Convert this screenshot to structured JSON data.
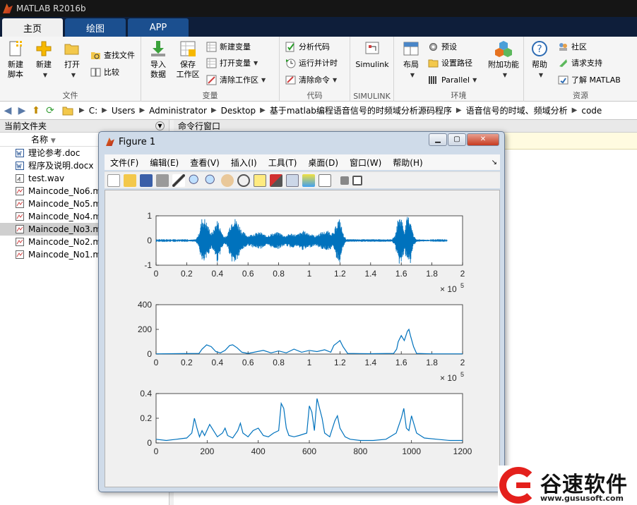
{
  "window": {
    "title": "MATLAB R2016b"
  },
  "tabs": [
    {
      "label": "主页"
    },
    {
      "label": "绘图"
    },
    {
      "label": "APP"
    }
  ],
  "ribbon": {
    "file": {
      "name": "文件",
      "new_script": "新建\n脚本",
      "new": "新建",
      "open": "打开",
      "find_files": "查找文件",
      "compare": "比较"
    },
    "variable": {
      "name": "变量",
      "import": "导入\n数据",
      "save_ws": "保存\n工作区",
      "new_var": "新建变量",
      "open_var": "打开变量",
      "clear_ws": "清除工作区"
    },
    "code": {
      "name": "代码",
      "analyze": "分析代码",
      "run_time": "运行并计时",
      "clear_cmds": "清除命令"
    },
    "simulink": {
      "name": "SIMULINK",
      "label": "Simulink"
    },
    "env": {
      "name": "环境",
      "layout": "布局",
      "prefs": "预设",
      "set_path": "设置路径",
      "parallel": "Parallel",
      "addons": "附加功能"
    },
    "resources": {
      "name": "资源",
      "help": "帮助",
      "community": "社区",
      "support": "请求支持",
      "learn": "了解 MATLAB"
    }
  },
  "address": {
    "segments": [
      "C:",
      "Users",
      "Administrator",
      "Desktop",
      "基于matlab编程语音信号的时频域分析源码程序",
      "语音信号的时域、频域分析",
      "code"
    ]
  },
  "current_folder": {
    "title": "当前文件夹",
    "col_name": "名称",
    "files": [
      {
        "name": "理论参考.doc",
        "type": "doc"
      },
      {
        "name": "程序及说明.docx",
        "type": "doc"
      },
      {
        "name": "test.wav",
        "type": "wav"
      },
      {
        "name": "Maincode_No6.m",
        "type": "m"
      },
      {
        "name": "Maincode_No5.m",
        "type": "m"
      },
      {
        "name": "Maincode_No4.m",
        "type": "m"
      },
      {
        "name": "Maincode_No3.m",
        "type": "m",
        "selected": true
      },
      {
        "name": "Maincode_No2.m",
        "type": "m"
      },
      {
        "name": "Maincode_No1.m",
        "type": "m"
      }
    ]
  },
  "command_window": {
    "title": "命令行窗口"
  },
  "figure": {
    "title": "Figure 1",
    "menu": [
      "文件(F)",
      "编辑(E)",
      "查看(V)",
      "插入(I)",
      "工具(T)",
      "桌面(D)",
      "窗口(W)",
      "帮助(H)"
    ]
  },
  "chart_data": [
    {
      "type": "line",
      "ylim": [
        -1,
        1
      ],
      "xlim": [
        0,
        2
      ],
      "xticks": [
        "0",
        "0.2",
        "0.4",
        "0.6",
        "0.8",
        "1",
        "1.2",
        "1.4",
        "1.6",
        "1.8",
        "2"
      ],
      "yticks": [
        "1",
        "0",
        "-1"
      ],
      "exponent": "× 10",
      "exponent_power": "5",
      "envelope_x": [
        0,
        0.2,
        0.26,
        0.28,
        0.3,
        0.32,
        0.34,
        0.36,
        0.38,
        0.4,
        0.42,
        0.44,
        0.46,
        0.48,
        0.5,
        0.52,
        0.54,
        0.56,
        0.58,
        0.6,
        0.64,
        0.68,
        0.72,
        0.76,
        0.8,
        0.84,
        0.88,
        0.92,
        0.96,
        1.0,
        1.04,
        1.08,
        1.12,
        1.16,
        1.18,
        1.2,
        1.22,
        1.24,
        1.3,
        1.4,
        1.5,
        1.54,
        1.56,
        1.58,
        1.6,
        1.62,
        1.64,
        1.66,
        1.68,
        1.7,
        1.8,
        1.9,
        1.92,
        2.0
      ],
      "envelope_y": [
        0.02,
        0.02,
        0.05,
        0.3,
        0.95,
        0.9,
        0.6,
        0.3,
        0.5,
        0.9,
        0.5,
        0.2,
        0.15,
        0.6,
        0.95,
        0.9,
        0.7,
        0.4,
        0.3,
        0.2,
        0.3,
        0.35,
        0.2,
        0.3,
        0.35,
        0.2,
        0.3,
        0.25,
        0.4,
        0.3,
        0.2,
        0.35,
        0.4,
        0.3,
        0.8,
        0.9,
        0.3,
        0.05,
        0.05,
        0.05,
        0.05,
        0.05,
        0.2,
        0.95,
        1.0,
        0.4,
        1.0,
        0.95,
        0.2,
        0.05,
        0.02,
        0.02,
        0.0,
        0.0
      ]
    },
    {
      "type": "line",
      "ylim": [
        0,
        400
      ],
      "xlim": [
        0,
        2
      ],
      "xticks": [
        "0",
        "0.2",
        "0.4",
        "0.6",
        "0.8",
        "1",
        "1.2",
        "1.4",
        "1.6",
        "1.8",
        "2"
      ],
      "yticks": [
        "400",
        "200",
        "0"
      ],
      "exponent": "× 10",
      "exponent_power": "5",
      "x": [
        0,
        0.28,
        0.3,
        0.33,
        0.36,
        0.39,
        0.42,
        0.45,
        0.48,
        0.5,
        0.53,
        0.56,
        0.6,
        0.7,
        0.75,
        0.8,
        0.85,
        0.9,
        0.95,
        1.0,
        1.05,
        1.1,
        1.14,
        1.16,
        1.18,
        1.2,
        1.22,
        1.25,
        1.4,
        1.55,
        1.57,
        1.58,
        1.6,
        1.62,
        1.64,
        1.65,
        1.66,
        1.68,
        1.7,
        1.8,
        2.0
      ],
      "y": [
        2,
        5,
        40,
        75,
        60,
        20,
        10,
        30,
        70,
        75,
        50,
        15,
        5,
        30,
        10,
        25,
        10,
        40,
        15,
        30,
        20,
        35,
        15,
        70,
        90,
        110,
        60,
        5,
        3,
        5,
        40,
        100,
        150,
        110,
        185,
        200,
        150,
        60,
        5,
        2,
        2
      ]
    },
    {
      "type": "line",
      "ylim": [
        0,
        0.4
      ],
      "xlim": [
        0,
        1200
      ],
      "xticks": [
        "0",
        "200",
        "400",
        "600",
        "800",
        "1000",
        "1200"
      ],
      "yticks": [
        "0.4",
        "0.2",
        "0"
      ],
      "x": [
        0,
        40,
        80,
        120,
        140,
        150,
        160,
        170,
        180,
        190,
        210,
        240,
        260,
        270,
        280,
        300,
        320,
        330,
        340,
        360,
        380,
        400,
        420,
        440,
        460,
        480,
        490,
        500,
        510,
        520,
        540,
        560,
        590,
        600,
        610,
        620,
        630,
        640,
        650,
        660,
        680,
        700,
        710,
        720,
        740,
        760,
        800,
        850,
        900,
        940,
        960,
        970,
        980,
        990,
        1000,
        1020,
        1050,
        1100,
        1150,
        1200
      ],
      "y": [
        0.03,
        0.02,
        0.03,
        0.04,
        0.08,
        0.2,
        0.12,
        0.05,
        0.1,
        0.06,
        0.15,
        0.05,
        0.08,
        0.12,
        0.06,
        0.04,
        0.1,
        0.16,
        0.08,
        0.05,
        0.1,
        0.12,
        0.06,
        0.05,
        0.08,
        0.1,
        0.32,
        0.28,
        0.12,
        0.06,
        0.05,
        0.06,
        0.08,
        0.3,
        0.25,
        0.1,
        0.36,
        0.28,
        0.2,
        0.08,
        0.05,
        0.18,
        0.22,
        0.12,
        0.05,
        0.03,
        0.02,
        0.02,
        0.03,
        0.08,
        0.2,
        0.28,
        0.12,
        0.1,
        0.22,
        0.08,
        0.04,
        0.03,
        0.02,
        0.02
      ]
    }
  ],
  "colors": {
    "plot_line": "#0072bd",
    "ribbon_bg": "#f5f5f5",
    "tab_active": "#f0f0f0",
    "tab_inactive": "#1b4f8f",
    "watermark_red": "#e4201c"
  },
  "watermark": {
    "brand": "谷速软件",
    "url": "www.gususoft.com"
  }
}
